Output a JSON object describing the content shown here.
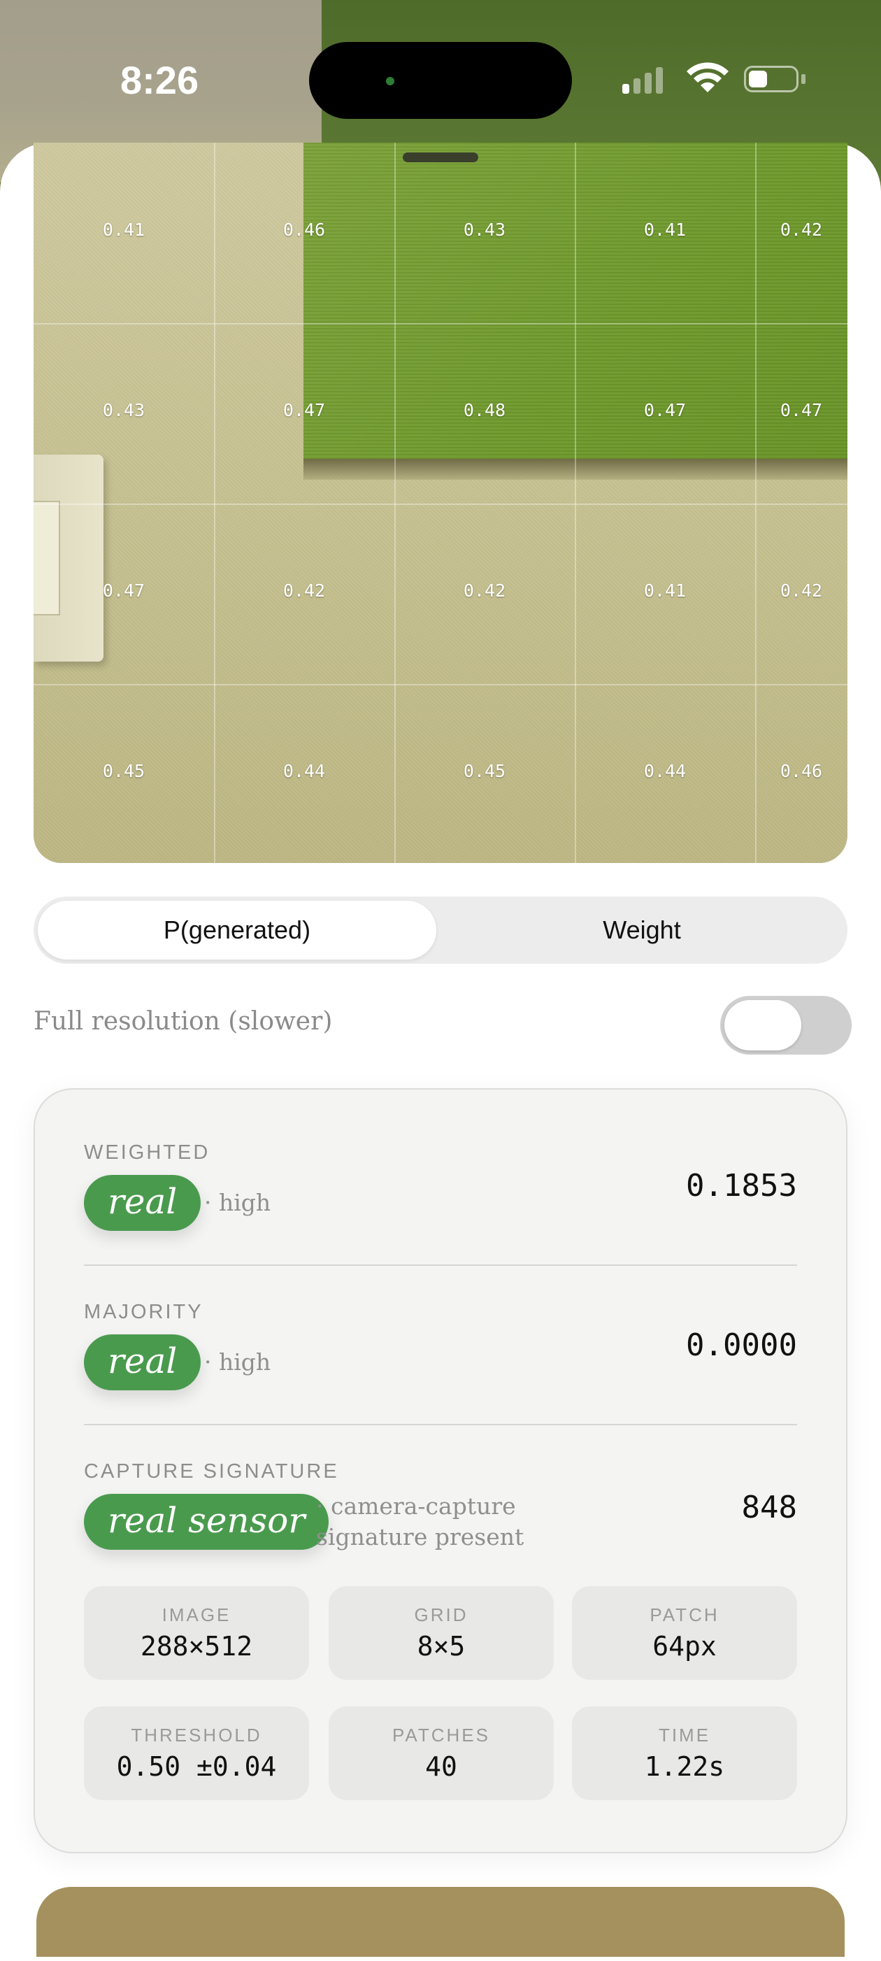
{
  "status_bar": {
    "time": "8:26"
  },
  "heatmap": {
    "columns": 5,
    "rows": 4,
    "values": [
      [
        "0.41",
        "0.46",
        "0.43",
        "0.41",
        "0.42"
      ],
      [
        "0.43",
        "0.47",
        "0.48",
        "0.47",
        "0.47"
      ],
      [
        "0.47",
        "0.42",
        "0.42",
        "0.41",
        "0.42"
      ],
      [
        "0.45",
        "0.44",
        "0.45",
        "0.44",
        "0.46"
      ]
    ]
  },
  "segmented": {
    "options": [
      "P(generated)",
      "Weight"
    ],
    "selected": "P(generated)"
  },
  "toggle": {
    "label": "Full resolution (slower)",
    "on": false
  },
  "results": {
    "weighted": {
      "label": "WEIGHTED",
      "verdict": "real",
      "note": "· high",
      "score": "0.1853"
    },
    "majority": {
      "label": "MAJORITY",
      "verdict": "real",
      "note": "· high",
      "score": "0.0000"
    },
    "capture": {
      "label": "CAPTURE SIGNATURE",
      "verdict": "real sensor",
      "note_line1": "· camera-capture",
      "note_line2": "signature present",
      "score": "848"
    },
    "stats": [
      {
        "label": "IMAGE",
        "value": "288×512"
      },
      {
        "label": "GRID",
        "value": "8×5"
      },
      {
        "label": "PATCH",
        "value": "64px"
      },
      {
        "label": "THRESHOLD",
        "value": "0.50 ±0.04"
      },
      {
        "label": "PATCHES",
        "value": "40"
      },
      {
        "label": "TIME",
        "value": "1.22s"
      }
    ]
  },
  "colors": {
    "accent_green": "#4a9a4e",
    "bottom_card": "#a5915e"
  }
}
